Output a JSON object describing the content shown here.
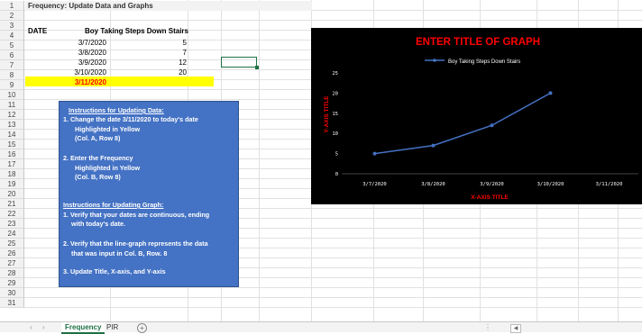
{
  "sheet": {
    "row_numbers": [
      "1",
      "2",
      "3",
      "4",
      "5",
      "6",
      "7",
      "8",
      "9",
      "10",
      "11",
      "12",
      "13",
      "14",
      "15",
      "16",
      "17",
      "18",
      "19",
      "20",
      "21",
      "22",
      "23",
      "24",
      "25",
      "26",
      "27",
      "28",
      "29",
      "30",
      "31"
    ],
    "title": "Frequency: Update Data and Graphs",
    "headers": {
      "date": "DATE",
      "freq": "Boy Taking Steps Down Stairs"
    },
    "rows": [
      {
        "date": "3/7/2020",
        "value": "5"
      },
      {
        "date": "3/8/2020",
        "value": "7"
      },
      {
        "date": "3/9/2020",
        "value": "12"
      },
      {
        "date": "3/10/2020",
        "value": "20"
      },
      {
        "date": "3/11/2020",
        "value": ""
      }
    ],
    "highlight_color": "#ffff00",
    "selection_color": "#1e7145"
  },
  "instructions": {
    "data_heading": "Instructions for Updating Data:",
    "data_step1_a": "1.  Change the date 3/11/2020 to today's date",
    "data_step1_b": "Highlighted in Yellow",
    "data_step1_c": "(Col. A, Row 8)",
    "data_step2_a": "2.  Enter the Frequency",
    "data_step2_b": "Highlighted in Yellow",
    "data_step2_c": "(Col. B, Row 8)",
    "graph_heading": "Instructions for Updating Graph:",
    "graph_step1_a": "1. Verify that your dates are continuous, ending",
    "graph_step1_b": "with today's date.",
    "graph_step2_a": "2. Verify that the line-graph represents the data",
    "graph_step2_b": "that was input in Col. B, Row. 8",
    "graph_step3": "3. Update Title, X-axis, and Y-axis",
    "box_color": "#4472c4"
  },
  "chart_data": {
    "type": "line",
    "title": "ENTER TITLE OF GRAPH",
    "xlabel": "X-AXIS TITLE",
    "ylabel": "Y-AXIS TITLE",
    "categories": [
      "3/7/2020",
      "3/8/2020",
      "3/9/2020",
      "3/10/2020",
      "3/11/2020"
    ],
    "series": [
      {
        "name": "Boy Taking Steps Down Stairs",
        "values": [
          5,
          7,
          12,
          20,
          null
        ]
      }
    ],
    "ylim": [
      0,
      25
    ],
    "yticks": [
      "0",
      "5",
      "10",
      "15",
      "20",
      "25"
    ],
    "grid": false,
    "legend": "top-center",
    "background": "#000000",
    "title_color": "#ff0000",
    "axis_title_color": "#ff0000",
    "line_color": "#4472c4"
  },
  "tabs": {
    "nav_prev": "‹",
    "nav_next": "›",
    "items": [
      "Frequency",
      "PIR"
    ],
    "active": "Frequency",
    "add": "+"
  }
}
